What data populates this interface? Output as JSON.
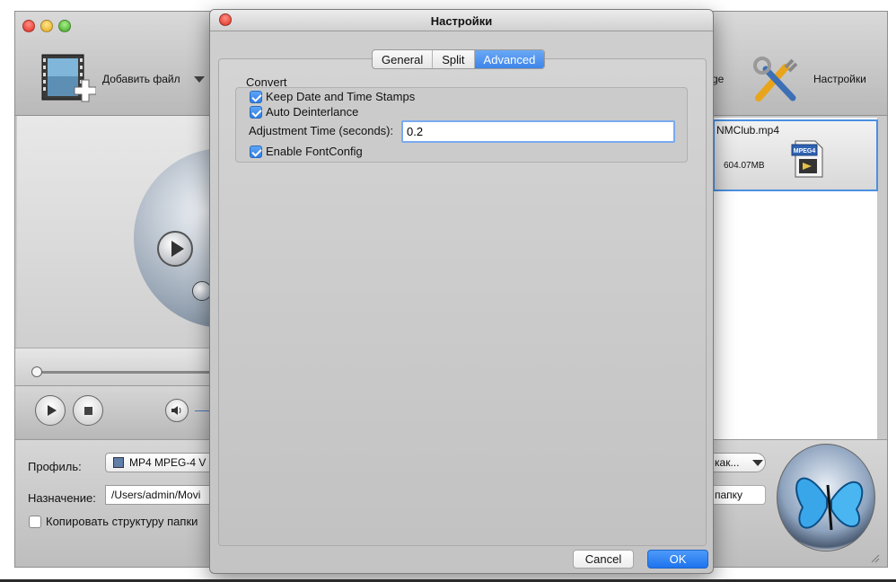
{
  "main": {
    "toolbar": {
      "add_file_label": "Добавить файл",
      "merge_label_fragment": "ge",
      "settings_label": "Настройки"
    },
    "file_list": {
      "items": [
        {
          "name": "NMClub.mp4",
          "size": "604.07MB",
          "type_badge": "MPEG4"
        }
      ]
    },
    "bottom": {
      "profile_label": "Профиль:",
      "profile_value": "MP4 MPEG-4 V",
      "destination_label": "Назначение:",
      "destination_value": "/Users/admin/Movi",
      "copy_structure_label": "Копировать структуру папки",
      "copy_structure_checked": false,
      "save_as_fragment": "как...",
      "folder_button_fragment": "папку"
    }
  },
  "dialog": {
    "title": "Настройки",
    "tabs": [
      {
        "label": "General",
        "active": false
      },
      {
        "label": "Split",
        "active": false
      },
      {
        "label": "Advanced",
        "active": true
      }
    ],
    "convert": {
      "legend": "Convert",
      "keep_date_label": "Keep Date and Time Stamps",
      "keep_date_checked": true,
      "auto_deinterlance_label": "Auto Deinterlance",
      "auto_deinterlance_checked": true,
      "adjustment_label": "Adjustment Time (seconds):",
      "adjustment_value": "0.2",
      "enable_fontconfig_label": "Enable FontConfig",
      "enable_fontconfig_checked": true
    },
    "cancel_label": "Cancel",
    "ok_label": "OK"
  },
  "colors": {
    "accent": "#3d85ea",
    "selection_border": "#4a90e2"
  }
}
